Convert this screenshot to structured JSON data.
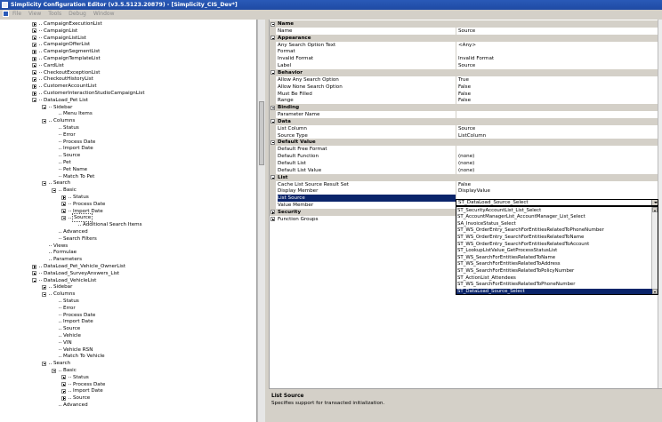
{
  "window": {
    "title": "Simplicity Configuration Editor (v3.5.5123.20879) - [Simplicity_CIS_Dev*]"
  },
  "menu": [
    "File",
    "View",
    "Tools",
    "Debug",
    "Window"
  ],
  "tree": [
    {
      "label": "CampaignExecutionList",
      "indent": 0,
      "exp": "plus"
    },
    {
      "label": "CampaignList",
      "indent": 0,
      "exp": "plus"
    },
    {
      "label": "CampaignListList",
      "indent": 0,
      "exp": "plus"
    },
    {
      "label": "CampaignOfferList",
      "indent": 0,
      "exp": "plus"
    },
    {
      "label": "CampaignSegmentList",
      "indent": 0,
      "exp": "plus"
    },
    {
      "label": "CampaignTemplateList",
      "indent": 0,
      "exp": "plus"
    },
    {
      "label": "CardList",
      "indent": 0,
      "exp": "plus"
    },
    {
      "label": "CheckoutExceptionList",
      "indent": 0,
      "exp": "plus"
    },
    {
      "label": "CheckoutHistoryList",
      "indent": 0,
      "exp": "plus"
    },
    {
      "label": "CustomerAccountList",
      "indent": 0,
      "exp": "plus"
    },
    {
      "label": "CustomerInteractionStudioCampaignList",
      "indent": 0,
      "exp": "plus"
    },
    {
      "label": "DataLoad_Pet List",
      "indent": 0,
      "exp": "minus"
    },
    {
      "label": "Sidebar",
      "indent": 1,
      "exp": "minus"
    },
    {
      "label": "Menu Items",
      "indent": 2,
      "exp": "none"
    },
    {
      "label": "Columns",
      "indent": 1,
      "exp": "minus"
    },
    {
      "label": "Status",
      "indent": 2,
      "exp": "none"
    },
    {
      "label": "Error",
      "indent": 2,
      "exp": "none"
    },
    {
      "label": "Process Date",
      "indent": 2,
      "exp": "none"
    },
    {
      "label": "Import Date",
      "indent": 2,
      "exp": "none"
    },
    {
      "label": "Source",
      "indent": 2,
      "exp": "none"
    },
    {
      "label": "Pet",
      "indent": 2,
      "exp": "none"
    },
    {
      "label": "Pet Name",
      "indent": 2,
      "exp": "none"
    },
    {
      "label": "Match To Pet",
      "indent": 2,
      "exp": "none"
    },
    {
      "label": "Search",
      "indent": 1,
      "exp": "minus"
    },
    {
      "label": "Basic",
      "indent": 2,
      "exp": "minus"
    },
    {
      "label": "Status",
      "indent": 3,
      "exp": "plus"
    },
    {
      "label": "Process Date",
      "indent": 3,
      "exp": "plus"
    },
    {
      "label": "Import Date",
      "indent": 3,
      "exp": "plus"
    },
    {
      "label": "Source",
      "indent": 3,
      "exp": "minus",
      "selected": true
    },
    {
      "label": "Additional Search Items",
      "indent": 4,
      "exp": "none"
    },
    {
      "label": "Advanced",
      "indent": 2,
      "exp": "none"
    },
    {
      "label": "Search Filters",
      "indent": 2,
      "exp": "none"
    },
    {
      "label": "Views",
      "indent": 1,
      "exp": "none"
    },
    {
      "label": "Formulae",
      "indent": 1,
      "exp": "none"
    },
    {
      "label": "Parameters",
      "indent": 1,
      "exp": "none"
    },
    {
      "label": "DataLoad_Pet_Vehicle_OwnerList",
      "indent": 0,
      "exp": "plus"
    },
    {
      "label": "DataLoad_SurveyAnswers_List",
      "indent": 0,
      "exp": "plus"
    },
    {
      "label": "DataLoad_VehicleList",
      "indent": 0,
      "exp": "minus"
    },
    {
      "label": "Sidebar",
      "indent": 1,
      "exp": "plus"
    },
    {
      "label": "Columns",
      "indent": 1,
      "exp": "minus"
    },
    {
      "label": "Status",
      "indent": 2,
      "exp": "none"
    },
    {
      "label": "Error",
      "indent": 2,
      "exp": "none"
    },
    {
      "label": "Process Date",
      "indent": 2,
      "exp": "none"
    },
    {
      "label": "Import Date",
      "indent": 2,
      "exp": "none"
    },
    {
      "label": "Source",
      "indent": 2,
      "exp": "none"
    },
    {
      "label": "Vehicle",
      "indent": 2,
      "exp": "none"
    },
    {
      "label": "VIN",
      "indent": 2,
      "exp": "none"
    },
    {
      "label": "Vehicle RSN",
      "indent": 2,
      "exp": "none"
    },
    {
      "label": "Match To Vehicle",
      "indent": 2,
      "exp": "none"
    },
    {
      "label": "Search",
      "indent": 1,
      "exp": "minus"
    },
    {
      "label": "Basic",
      "indent": 2,
      "exp": "minus"
    },
    {
      "label": "Status",
      "indent": 3,
      "exp": "plus"
    },
    {
      "label": "Process Date",
      "indent": 3,
      "exp": "plus"
    },
    {
      "label": "Import Date",
      "indent": 3,
      "exp": "plus"
    },
    {
      "label": "Source",
      "indent": 3,
      "exp": "plus"
    },
    {
      "label": "Advanced",
      "indent": 2,
      "exp": "none"
    }
  ],
  "properties": [
    {
      "type": "cat",
      "name": "Name",
      "exp": "minus"
    },
    {
      "type": "prop",
      "name": "Name",
      "value": "Source"
    },
    {
      "type": "cat",
      "name": "Appearance",
      "exp": "minus"
    },
    {
      "type": "prop",
      "name": "Any Search Option Text",
      "value": "<Any>"
    },
    {
      "type": "prop",
      "name": "Format",
      "value": ""
    },
    {
      "type": "prop",
      "name": "Invalid Format",
      "value": "Invalid Format"
    },
    {
      "type": "prop",
      "name": "Label",
      "value": "Source"
    },
    {
      "type": "cat",
      "name": "Behavior",
      "exp": "minus"
    },
    {
      "type": "prop",
      "name": "Allow Any Search Option",
      "value": "True"
    },
    {
      "type": "prop",
      "name": "Allow None Search Option",
      "value": "False"
    },
    {
      "type": "prop",
      "name": "Must Be Filled",
      "value": "False"
    },
    {
      "type": "prop",
      "name": "Range",
      "value": "False"
    },
    {
      "type": "cat",
      "name": "Binding",
      "exp": "minus"
    },
    {
      "type": "prop",
      "name": "Parameter Name",
      "value": ""
    },
    {
      "type": "cat",
      "name": "Data",
      "exp": "minus"
    },
    {
      "type": "prop",
      "name": "List Column",
      "value": "Source"
    },
    {
      "type": "prop",
      "name": "Source Type",
      "value": "ListColumn"
    },
    {
      "type": "cat",
      "name": "Default Value",
      "exp": "minus"
    },
    {
      "type": "prop",
      "name": "Default Free Format",
      "value": ""
    },
    {
      "type": "prop",
      "name": "Default Function",
      "value": "(none)"
    },
    {
      "type": "prop",
      "name": "Default List",
      "value": "(none)"
    },
    {
      "type": "prop",
      "name": "Default List Value",
      "value": "(none)"
    },
    {
      "type": "cat",
      "name": "List",
      "exp": "minus"
    },
    {
      "type": "prop",
      "name": "Cache List Source Result Set",
      "value": "False"
    },
    {
      "type": "prop",
      "name": "Display Member",
      "value": "DisplayValue"
    },
    {
      "type": "prop",
      "name": "List Source",
      "value": "",
      "selected": true
    },
    {
      "type": "prop",
      "name": "Value Member",
      "value": ""
    },
    {
      "type": "cat",
      "name": "Security",
      "exp": "plus"
    },
    {
      "type": "cat",
      "name": "Function Groups",
      "exp": "plus",
      "light": true
    }
  ],
  "dropdown": {
    "value": "ST_DataLoad_Source_Select",
    "options": [
      "ST_SecurityAccountList_List_Select",
      "ST_AccountManagerList_AccountManager_List_Select",
      "SA_InvoiceStatus_Select",
      "ST_WS_OrderEntry_SearchForEntitiesRelatedToPhoneNumber",
      "ST_WS_OrderEntry_SearchForEntitiesRelatedToName",
      "ST_WS_OrderEntry_SearchForEntitiesRelatedToAccount",
      "ST_LookupListValue_GetProcessStatusList",
      "ST_WS_SearchForEntitiesRelatedToName",
      "ST_WS_SearchForEntitiesRelatedToAddress",
      "ST_WS_SearchForEntitiesRelatedToPolicyNumber",
      "ST_ActionList_Attendees",
      "ST_WS_SearchForEntitiesRelatedToPhoneNumber",
      "ST_DataLoad_Source_Select"
    ],
    "selected_index": 12
  },
  "description": {
    "title": "List Source",
    "text": "Specifies support for transacted initialization."
  }
}
